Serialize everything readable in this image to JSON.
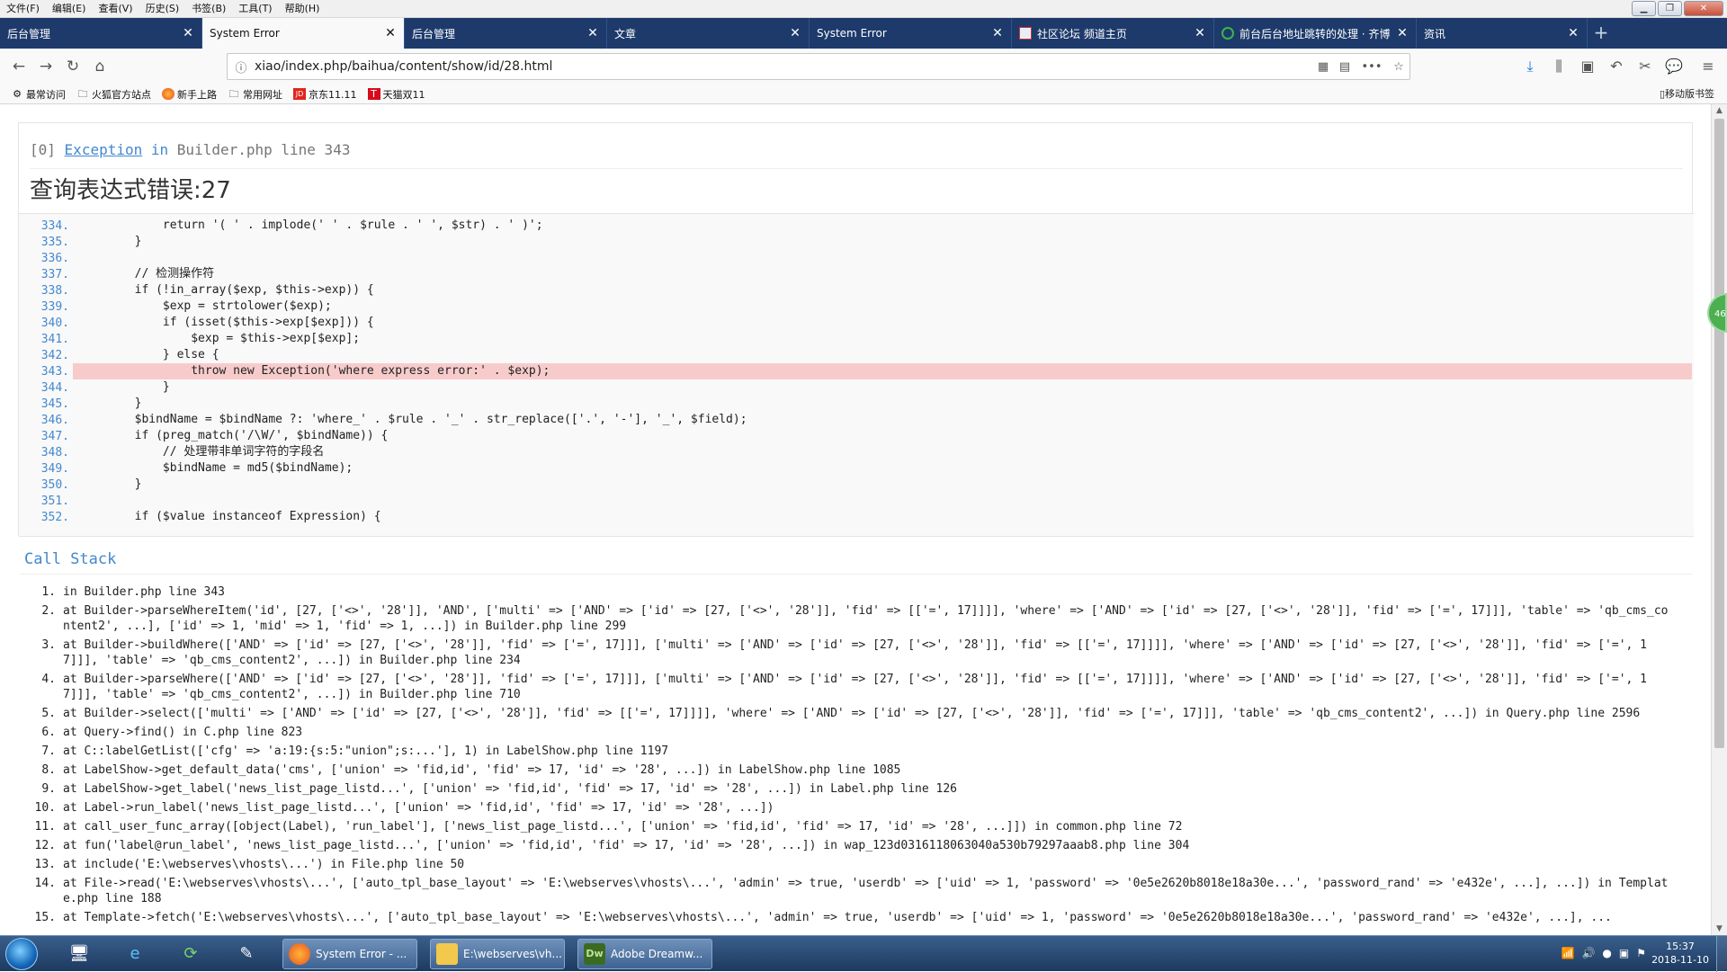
{
  "menubar": {
    "items": [
      "文件(F)",
      "编辑(E)",
      "查看(V)",
      "历史(S)",
      "书签(B)",
      "工具(T)",
      "帮助(H)"
    ]
  },
  "tabs": [
    {
      "label": "后台管理",
      "active": false,
      "icon": ""
    },
    {
      "label": "System Error",
      "active": true,
      "icon": ""
    },
    {
      "label": "后台管理",
      "active": false,
      "icon": ""
    },
    {
      "label": "文章",
      "active": false,
      "icon": ""
    },
    {
      "label": "System Error",
      "active": false,
      "icon": ""
    },
    {
      "label": "社区论坛 频道主页",
      "active": false,
      "icon": "site-icon"
    },
    {
      "label": "前台后台地址跳转的处理 · 齐博",
      "active": false,
      "icon": "wechat-icon"
    },
    {
      "label": "资讯",
      "active": false,
      "icon": ""
    }
  ],
  "nav": {
    "url": "xiao/index.php/baihua/content/show/id/28.html"
  },
  "bookmarks": [
    {
      "label": "最常访问",
      "icon": "gear-icon"
    },
    {
      "label": "火狐官方站点",
      "icon": "folder-icon"
    },
    {
      "label": "新手上路",
      "icon": "firefox-icon"
    },
    {
      "label": "常用网址",
      "icon": "folder-icon"
    },
    {
      "label": "京东11.11",
      "icon": "jd-icon"
    },
    {
      "label": "天猫双11",
      "icon": "tmall-icon"
    }
  ],
  "mobile_bookmarks": "移动版书签",
  "exception": {
    "index": "[0]",
    "type": "Exception",
    "in": "in",
    "file": "Builder.php line 343",
    "message": "查询表达式错误:27"
  },
  "code_lines": [
    {
      "no": "334.",
      "code": "            return '( ' . implode(' ' . $rule . ' ', $str) . ' )';",
      "hl": false
    },
    {
      "no": "335.",
      "code": "        }",
      "hl": false
    },
    {
      "no": "336.",
      "code": "",
      "hl": false
    },
    {
      "no": "337.",
      "code": "        // 检测操作符",
      "hl": false
    },
    {
      "no": "338.",
      "code": "        if (!in_array($exp, $this->exp)) {",
      "hl": false
    },
    {
      "no": "339.",
      "code": "            $exp = strtolower($exp);",
      "hl": false
    },
    {
      "no": "340.",
      "code": "            if (isset($this->exp[$exp])) {",
      "hl": false
    },
    {
      "no": "341.",
      "code": "                $exp = $this->exp[$exp];",
      "hl": false
    },
    {
      "no": "342.",
      "code": "            } else {",
      "hl": false
    },
    {
      "no": "343.",
      "code": "                throw new Exception('where express error:' . $exp);",
      "hl": true
    },
    {
      "no": "344.",
      "code": "            }",
      "hl": false
    },
    {
      "no": "345.",
      "code": "        }",
      "hl": false
    },
    {
      "no": "346.",
      "code": "        $bindName = $bindName ?: 'where_' . $rule . '_' . str_replace(['.', '-'], '_', $field);",
      "hl": false
    },
    {
      "no": "347.",
      "code": "        if (preg_match('/\\W/', $bindName)) {",
      "hl": false
    },
    {
      "no": "348.",
      "code": "            // 处理带非单词字符的字段名",
      "hl": false
    },
    {
      "no": "349.",
      "code": "            $bindName = md5($bindName);",
      "hl": false
    },
    {
      "no": "350.",
      "code": "        }",
      "hl": false
    },
    {
      "no": "351.",
      "code": "",
      "hl": false
    },
    {
      "no": "352.",
      "code": "        if ($value instanceof Expression) {",
      "hl": false
    }
  ],
  "call_stack_title": "Call Stack",
  "call_stack": [
    {
      "n": "1.",
      "text": "in Builder.php line 343"
    },
    {
      "n": "2.",
      "text": "at Builder->parseWhereItem('id', [27, ['<>', '28']], 'AND', ['multi' => ['AND' => ['id' => [27, ['<>', '28']], 'fid' => [['=', 17]]]], 'where' => ['AND' => ['id' => [27, ['<>', '28']], 'fid' => ['=', 17]]], 'table' => 'qb_cms_content2', ...], ['id' => 1, 'mid' => 1, 'fid' => 1, ...]) in Builder.php line 299"
    },
    {
      "n": "3.",
      "text": "at Builder->buildWhere(['AND' => ['id' => [27, ['<>', '28']], 'fid' => ['=', 17]]], ['multi' => ['AND' => ['id' => [27, ['<>', '28']], 'fid' => [['=', 17]]]], 'where' => ['AND' => ['id' => [27, ['<>', '28']], 'fid' => ['=', 17]]], 'table' => 'qb_cms_content2', ...]) in Builder.php line 234"
    },
    {
      "n": "4.",
      "text": "at Builder->parseWhere(['AND' => ['id' => [27, ['<>', '28']], 'fid' => ['=', 17]]], ['multi' => ['AND' => ['id' => [27, ['<>', '28']], 'fid' => [['=', 17]]]], 'where' => ['AND' => ['id' => [27, ['<>', '28']], 'fid' => ['=', 17]]], 'table' => 'qb_cms_content2', ...]) in Builder.php line 710"
    },
    {
      "n": "5.",
      "text": "at Builder->select(['multi' => ['AND' => ['id' => [27, ['<>', '28']], 'fid' => [['=', 17]]]], 'where' => ['AND' => ['id' => [27, ['<>', '28']], 'fid' => ['=', 17]]], 'table' => 'qb_cms_content2', ...]) in Query.php line 2596"
    },
    {
      "n": "6.",
      "text": "at Query->find() in C.php line 823"
    },
    {
      "n": "7.",
      "text": "at C::labelGetList(['cfg' => 'a:19:{s:5:\"union\";s:...'], 1) in LabelShow.php line 1197"
    },
    {
      "n": "8.",
      "text": "at LabelShow->get_default_data('cms', ['union' => 'fid,id', 'fid' => 17, 'id' => '28', ...]) in LabelShow.php line 1085"
    },
    {
      "n": "9.",
      "text": "at LabelShow->get_label('news_list_page_listd...', ['union' => 'fid,id', 'fid' => 17, 'id' => '28', ...]) in Label.php line 126"
    },
    {
      "n": "10.",
      "text": "at Label->run_label('news_list_page_listd...', ['union' => 'fid,id', 'fid' => 17, 'id' => '28', ...])"
    },
    {
      "n": "11.",
      "text": "at call_user_func_array([object(Label), 'run_label'], ['news_list_page_listd...', ['union' => 'fid,id', 'fid' => 17, 'id' => '28', ...]]) in common.php line 72"
    },
    {
      "n": "12.",
      "text": "at fun('label@run_label', 'news_list_page_listd...', ['union' => 'fid,id', 'fid' => 17, 'id' => '28', ...]) in wap_123d0316118063040a530b79297aaab8.php line 304"
    },
    {
      "n": "13.",
      "text": "at include('E:\\webserves\\vhosts\\...') in File.php line 50"
    },
    {
      "n": "14.",
      "text": "at File->read('E:\\webserves\\vhosts\\...', ['auto_tpl_base_layout' => 'E:\\webserves\\vhosts\\...', 'admin' => true, 'userdb' => ['uid' => 1, 'password' => '0e5e2620b8018e18a30e...', 'password_rand' => 'e432e', ...], ...]) in Template.php line 188"
    },
    {
      "n": "15.",
      "text": "at Template->fetch('E:\\webserves\\vhosts\\...', ['auto_tpl_base_layout' => 'E:\\webserves\\vhosts\\...', 'admin' => true, 'userdb' => ['uid' => 1, 'password' => '0e5e2620b8018e18a30e...', 'password_rand' => 'e432e', ...], ..."
    }
  ],
  "side_badge": "46",
  "taskbar": {
    "tasks": [
      {
        "label": "System Error - ...",
        "icon": "firefox-icon"
      },
      {
        "label": "E:\\webserves\\vh...",
        "icon": "folder-icon"
      },
      {
        "label": "Adobe Dreamw...",
        "icon": "dreamweaver-icon",
        "badge": "Dw"
      }
    ],
    "time": "15:37",
    "date": "2018-11-10"
  }
}
